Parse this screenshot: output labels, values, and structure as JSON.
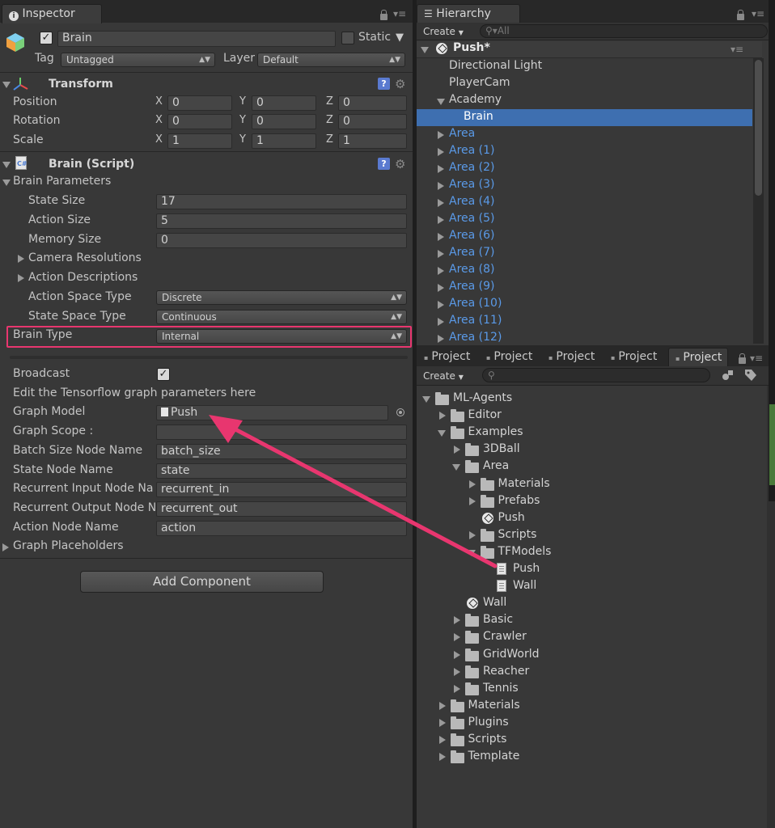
{
  "inspector": {
    "tab_label": "Inspector",
    "object_name": "Brain",
    "static_label": "Static",
    "tag_label": "Tag",
    "tag_value": "Untagged",
    "layer_label": "Layer",
    "layer_value": "Default",
    "transform": {
      "title": "Transform",
      "rows": [
        {
          "label": "Position",
          "x": "0",
          "y": "0",
          "z": "0"
        },
        {
          "label": "Rotation",
          "x": "0",
          "y": "0",
          "z": "0"
        },
        {
          "label": "Scale",
          "x": "1",
          "y": "1",
          "z": "1"
        }
      ],
      "axis_x": "X",
      "axis_y": "Y",
      "axis_z": "Z"
    },
    "brain_script": {
      "title": "Brain (Script)",
      "params_label": "Brain Parameters",
      "state_size_label": "State Size",
      "state_size": "17",
      "action_size_label": "Action Size",
      "action_size": "5",
      "memory_size_label": "Memory Size",
      "memory_size": "0",
      "camera_res_label": "Camera Resolutions",
      "action_desc_label": "Action Descriptions",
      "action_space_label": "Action Space Type",
      "action_space": "Discrete",
      "state_space_label": "State Space Type",
      "state_space": "Continuous",
      "brain_type_label": "Brain Type",
      "brain_type": "Internal",
      "broadcast_label": "Broadcast",
      "edit_note": "Edit the Tensorflow graph parameters here",
      "graph_model_label": "Graph Model",
      "graph_model": "Push",
      "graph_scope_label": "Graph Scope :",
      "graph_scope": "",
      "batch_label": "Batch Size Node Name",
      "batch_value": "batch_size",
      "state_node_label": "State Node Name",
      "state_node_value": "state",
      "rec_in_label": "Recurrent Input Node Na",
      "rec_in_value": "recurrent_in",
      "rec_out_label": "Recurrent Output Node N",
      "rec_out_value": "recurrent_out",
      "action_node_label": "Action Node Name",
      "action_node_value": "action",
      "placeholders_label": "Graph Placeholders"
    },
    "add_component": "Add Component"
  },
  "hierarchy": {
    "tab_label": "Hierarchy",
    "create_label": "Create",
    "search_placeholder": "All",
    "scene": "Push*",
    "items": [
      "Directional Light",
      "PlayerCam",
      "Academy",
      "Brain",
      "Area",
      "Area (1)",
      "Area (2)",
      "Area (3)",
      "Area (4)",
      "Area (5)",
      "Area (6)",
      "Area (7)",
      "Area (8)",
      "Area (9)",
      "Area (10)",
      "Area (11)",
      "Area (12)"
    ]
  },
  "project": {
    "tabs": [
      "Project",
      "Project",
      "Project",
      "Project",
      "Project"
    ],
    "create_label": "Create",
    "tree": [
      "ML-Agents",
      "Editor",
      "Examples",
      "3DBall",
      "Area",
      "Materials",
      "Prefabs",
      "Push",
      "Scripts",
      "TFModels",
      "Push",
      "Wall",
      "Wall",
      "Basic",
      "Crawler",
      "GridWorld",
      "Reacher",
      "Tennis",
      "Materials",
      "Plugins",
      "Scripts",
      "Template"
    ]
  },
  "colors": {
    "highlight": "#e8366f",
    "selection": "#3e6fb0",
    "link_blue": "#5a9ae8"
  }
}
